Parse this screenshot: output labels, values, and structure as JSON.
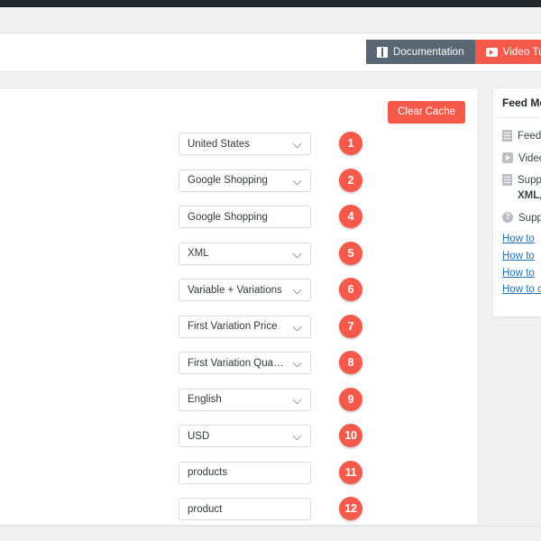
{
  "header": {
    "buttons": [
      {
        "label": "Documentation",
        "icon": "book-icon",
        "color": "#596673"
      },
      {
        "label": "Video Tutorial",
        "icon": "play-icon",
        "color": "#f4594c"
      }
    ]
  },
  "main": {
    "clear_cache_label": "Clear Cache",
    "rows": [
      {
        "badge": "1",
        "value": "United States",
        "type": "select"
      },
      {
        "badge": "2",
        "value": "Google Shopping",
        "type": "select"
      },
      {
        "badge": "4",
        "value": "Google Shopping",
        "type": "text"
      },
      {
        "badge": "5",
        "value": "XML",
        "type": "select"
      },
      {
        "badge": "6",
        "value": "Variable + Variations",
        "type": "select"
      },
      {
        "badge": "7",
        "value": "First Variation Price",
        "type": "select"
      },
      {
        "badge": "8",
        "value": "First Variation Quantity",
        "type": "select"
      },
      {
        "badge": "9",
        "value": "English",
        "type": "select"
      },
      {
        "badge": "10",
        "value": "USD",
        "type": "select"
      },
      {
        "badge": "11",
        "value": "products",
        "type": "text"
      },
      {
        "badge": "12",
        "value": "product",
        "type": "text"
      }
    ]
  },
  "sidebar": {
    "title": "Feed Mer",
    "items": [
      {
        "icon": "document-icon",
        "label": "Feed S"
      },
      {
        "icon": "video-icon",
        "label": "Video"
      },
      {
        "icon": "document-icon",
        "label": "Suppo",
        "sub": "XML, C"
      },
      {
        "icon": "help-icon",
        "label": "Suppo",
        "glyph": "?"
      }
    ],
    "links": [
      {
        "label": "How to"
      },
      {
        "label": "How to"
      },
      {
        "label": "How to"
      },
      {
        "label": "How to catego"
      }
    ]
  },
  "colors": {
    "accent_red": "#f4594c",
    "dark_slate": "#596673",
    "admin_bar": "#23282d",
    "link_blue": "#2271b1",
    "page_bg": "#f1f1f1"
  }
}
